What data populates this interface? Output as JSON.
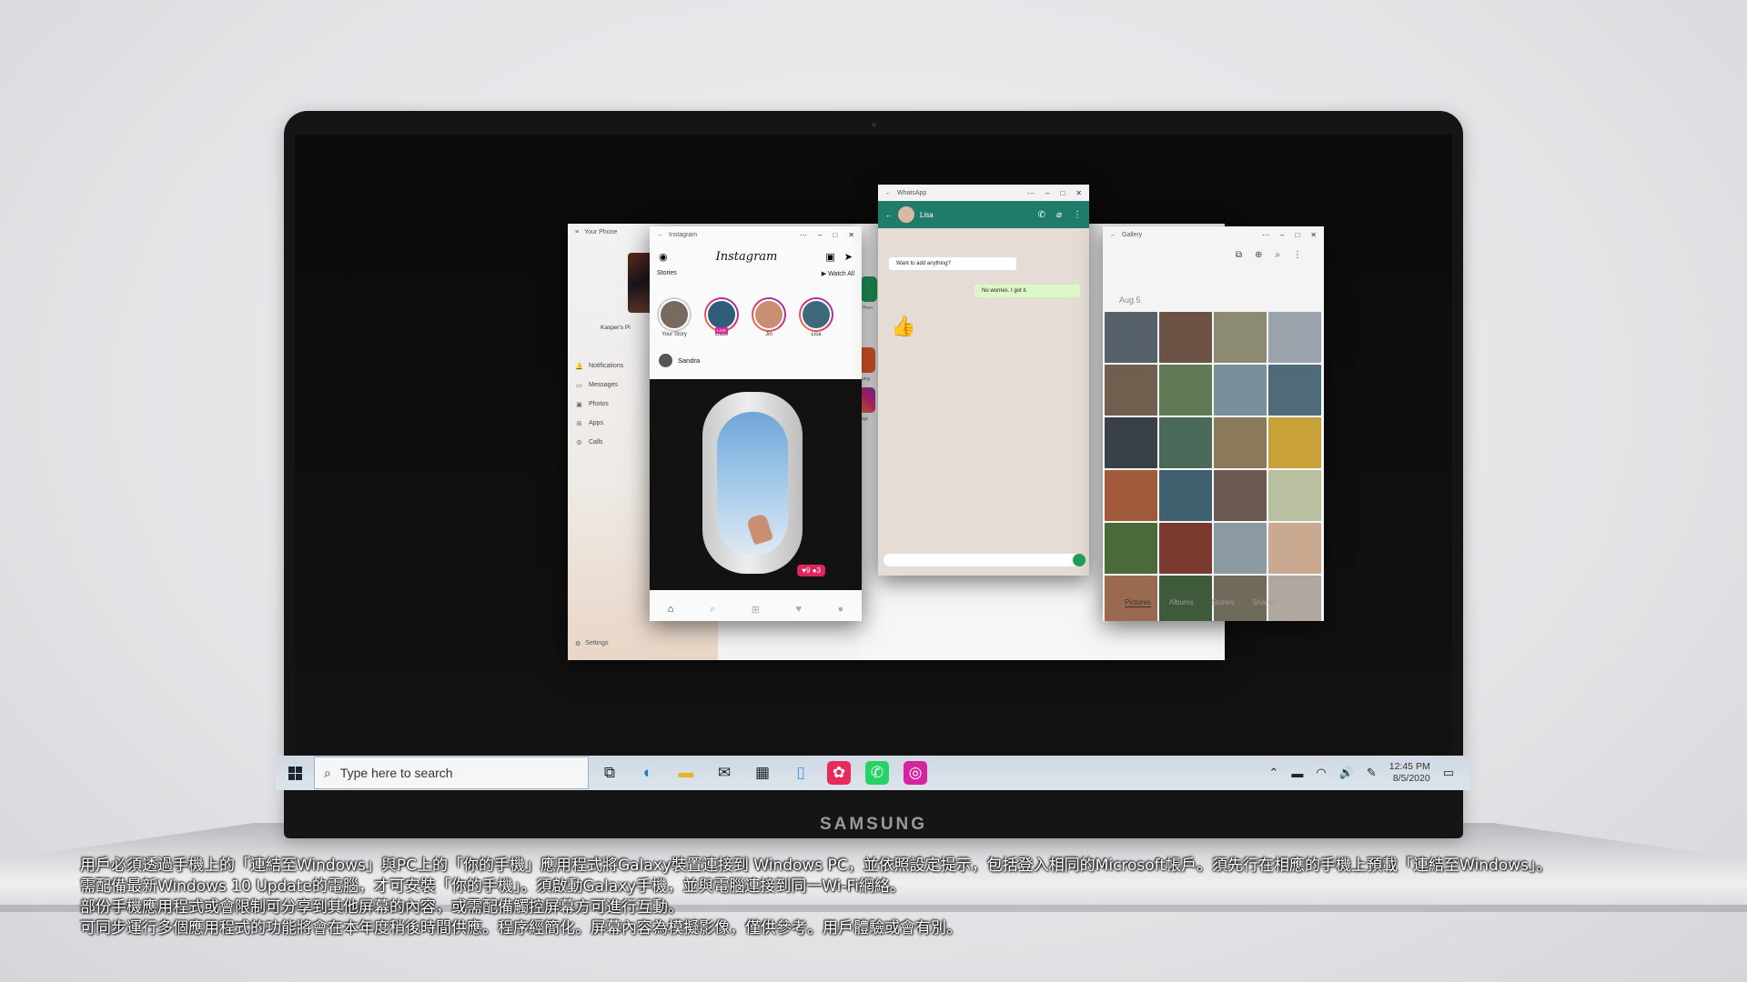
{
  "device": {
    "brand": "SAMSUNG"
  },
  "your_phone": {
    "title": "Your Phone",
    "owner": "Kasper's Pl",
    "nav": [
      {
        "icon": "bell-icon",
        "glyph": "🔔",
        "label": "Notifications"
      },
      {
        "icon": "chat-icon",
        "glyph": "▭",
        "label": "Messages"
      },
      {
        "icon": "photo-icon",
        "glyph": "▣",
        "label": "Photos"
      },
      {
        "icon": "apps-icon",
        "glyph": "⊞",
        "label": "Apps"
      },
      {
        "icon": "phone-icon",
        "glyph": "⚙",
        "label": "Calls"
      }
    ],
    "settings_label": "Settings",
    "app_labels": {
      "phone": "Phon",
      "samsung": "sung",
      "instagram": "stagr",
      "calendar": "alen"
    }
  },
  "instagram": {
    "title": "Instagram",
    "logo": "Instagram",
    "stories_label": "Stories",
    "watch_all": "▶ Watch All",
    "stories": [
      {
        "name": "Your Story"
      },
      {
        "name": "Gabe",
        "live": "LIVE"
      },
      {
        "name": "Jin"
      },
      {
        "name": "Lisa"
      }
    ],
    "post_author": "Sandra",
    "post_badge": "♥9 ●3"
  },
  "whatsapp": {
    "title": "WhatsApp",
    "contact": "Lisa",
    "messages": [
      {
        "dir": "in",
        "text": "Want to add anything?"
      },
      {
        "dir": "out",
        "text": "No worries. I got it."
      }
    ]
  },
  "gallery": {
    "title": "Gallery",
    "date": "Aug 5",
    "tabs": [
      "Pictures",
      "Albums",
      "Stories",
      "Shared"
    ],
    "active_tab": "Pictures",
    "thumb_colors": [
      "#55606a",
      "#6b5244",
      "#8c8a72",
      "#9aa3ac",
      "#6f5f4e",
      "#5f7a55",
      "#7b8f9a",
      "#4f6b7a",
      "#3a4048",
      "#4a6b5a",
      "#8a7a5a",
      "#c8a238",
      "#a05a3a",
      "#3f5e6e",
      "#6a5a4f",
      "#b8c0a0",
      "#4a6a3a",
      "#7a3a30",
      "#8a9aa0",
      "#c9a990",
      "#9a6a50",
      "#3e5a3a",
      "#6f6a5a",
      "#b0a8a0"
    ]
  },
  "taskbar": {
    "search_placeholder": "Type here to search",
    "time": "12:45 PM",
    "date": "8/5/2020",
    "apps": [
      {
        "icon": "task-view-icon",
        "glyph": "⧉",
        "color": "#1c2630",
        "bg": "transparent"
      },
      {
        "icon": "edge-icon",
        "glyph": "◐",
        "color": "#0f7fd1",
        "bg": "transparent"
      },
      {
        "icon": "file-explorer-icon",
        "glyph": "▬",
        "color": "#e8b430",
        "bg": "transparent"
      },
      {
        "icon": "mail-icon",
        "glyph": "✉",
        "color": "#1c2630",
        "bg": "transparent"
      },
      {
        "icon": "store-icon",
        "glyph": "▦",
        "color": "#1c2630",
        "bg": "transparent"
      },
      {
        "icon": "your-phone-icon",
        "glyph": "▯",
        "color": "#2f9ee8",
        "bg": "transparent"
      },
      {
        "icon": "samsung-flower-icon",
        "glyph": "✿",
        "color": "#ffffff",
        "bg": "#e8295a"
      },
      {
        "icon": "whatsapp-icon",
        "glyph": "✆",
        "color": "#ffffff",
        "bg": "#25d366"
      },
      {
        "icon": "instagram-icon",
        "glyph": "◎",
        "color": "#ffffff",
        "bg": "#d6249f"
      }
    ]
  },
  "captions": [
    "用戶必須透過手機上的「連結至Windows」與PC上的「你的手機」應用程式將Galaxy裝置連接到 Windows PC，並依照設定提示，包括登入相同的Microsoft帳戶。須先行在相應的手機上預載「連結至Windows」。",
    "需配備最新Windows 10 Update的電腦，才可安裝「你的手機」。須啟動Galaxy手機，並與電腦連接到同一Wi-Fi網絡。",
    "部份手機應用程式或會限制可分享到其他屏幕的內容，或需配備觸控屏幕方可進行互動。",
    "可同步運行多個應用程式的功能將會在本年度稍後時間供應。程序經簡化。屏幕內容為模擬影像，僅供參考。用戶體驗或會有別。"
  ]
}
